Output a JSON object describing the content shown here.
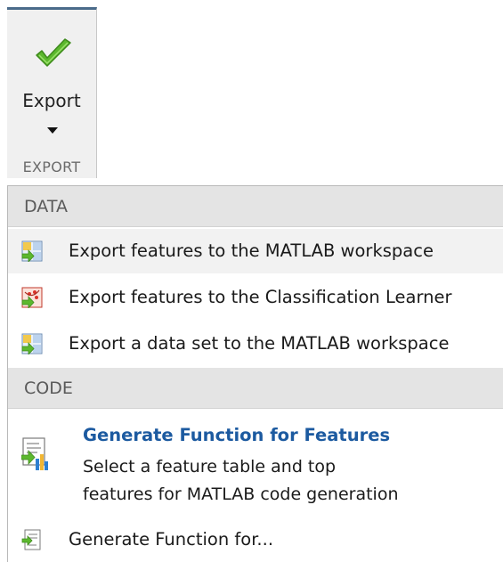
{
  "toolstrip": {
    "export_button_label": "Export",
    "group_label": "EXPORT",
    "icons": {
      "export": "green-checkmark-icon",
      "dropdown": "caret-down-icon"
    }
  },
  "menu": {
    "sections": [
      {
        "header": "DATA",
        "items": [
          {
            "label": "Export features to the MATLAB workspace",
            "icon": "workspace-export-icon"
          },
          {
            "label": "Export features to the Classification Learner",
            "icon": "classification-learner-icon"
          },
          {
            "label": "Export a data set to the MATLAB workspace",
            "icon": "workspace-export-icon"
          }
        ]
      },
      {
        "header": "CODE",
        "featured": {
          "title": "Generate Function for Features",
          "description_line1": "Select a feature table and top",
          "description_line2": "features for MATLAB code generation",
          "icon": "generate-function-chart-icon"
        },
        "items": [
          {
            "label": "Generate Function for...",
            "icon": "generate-function-icon"
          }
        ]
      }
    ]
  },
  "colors": {
    "accent_title": "#1c5aa0",
    "check_green": "#5cb82e",
    "header_bg": "#e4e4e4"
  }
}
